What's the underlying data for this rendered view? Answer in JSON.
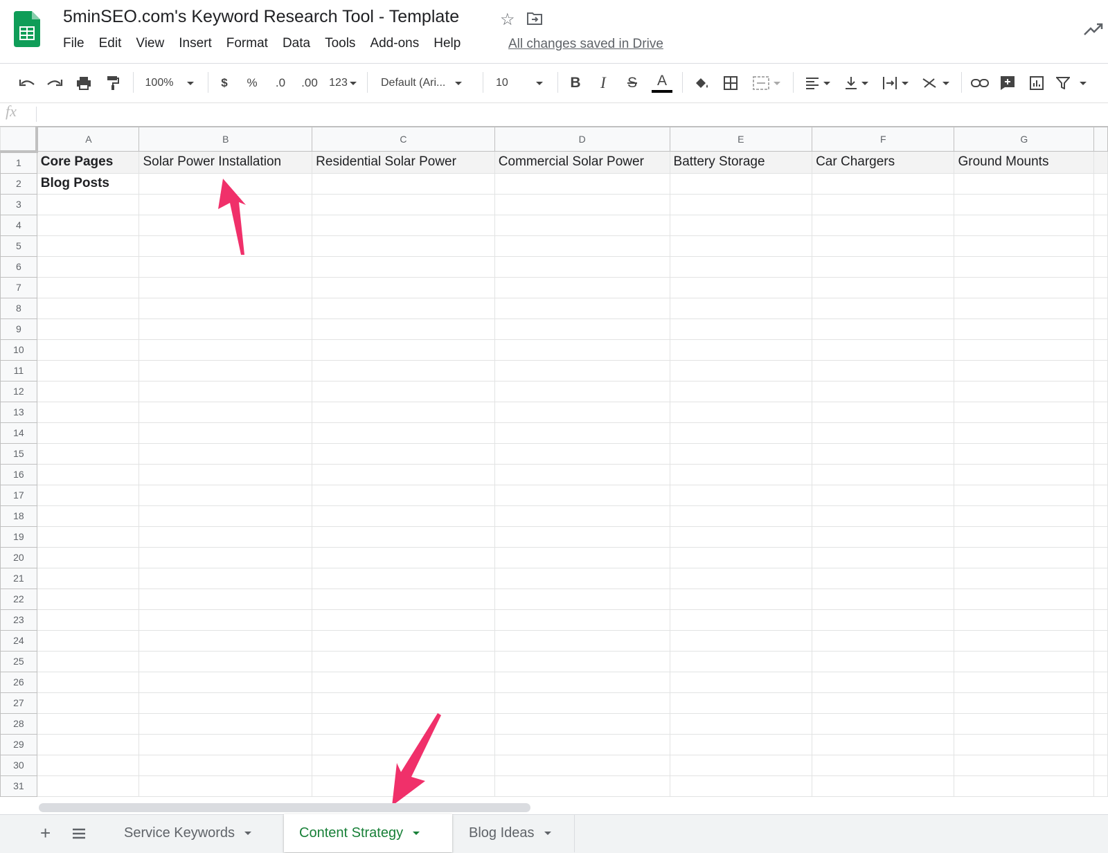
{
  "app": {
    "title": "5minSEO.com's Keyword  Research Tool - Template",
    "saved_status": "All changes saved in Drive",
    "menu": [
      "File",
      "Edit",
      "View",
      "Insert",
      "Format",
      "Data",
      "Tools",
      "Add-ons",
      "Help"
    ]
  },
  "toolbar": {
    "zoom": "100%",
    "currency": "$",
    "percent": "%",
    "decrease_decimal": ".0",
    "increase_decimal": ".00",
    "number_format": "123",
    "font": "Default (Ari...",
    "font_size": "10",
    "bold": "B",
    "italic": "I",
    "strike": "S",
    "text_color": "A"
  },
  "formula_bar": {
    "label": "fx",
    "value": ""
  },
  "grid": {
    "columns": [
      "A",
      "B",
      "C",
      "D",
      "E",
      "F",
      "G"
    ],
    "rows": [
      [
        "Core Pages",
        "Solar Power Installation",
        "Residential Solar Power",
        "Commercial Solar Power",
        "Battery Storage",
        "Car Chargers",
        "Ground Mounts"
      ],
      [
        "Blog Posts",
        "",
        "",
        "",
        "",
        "",
        ""
      ]
    ],
    "row_count": 31
  },
  "sheets": {
    "tabs": [
      {
        "label": "Service Keywords",
        "active": false
      },
      {
        "label": "Content Strategy",
        "active": true
      },
      {
        "label": "Blog Ideas",
        "active": false
      }
    ]
  },
  "colors": {
    "active_tab": "#188038",
    "annotation_arrow": "#f0306a",
    "sheets_logo": "#0f9d58"
  }
}
